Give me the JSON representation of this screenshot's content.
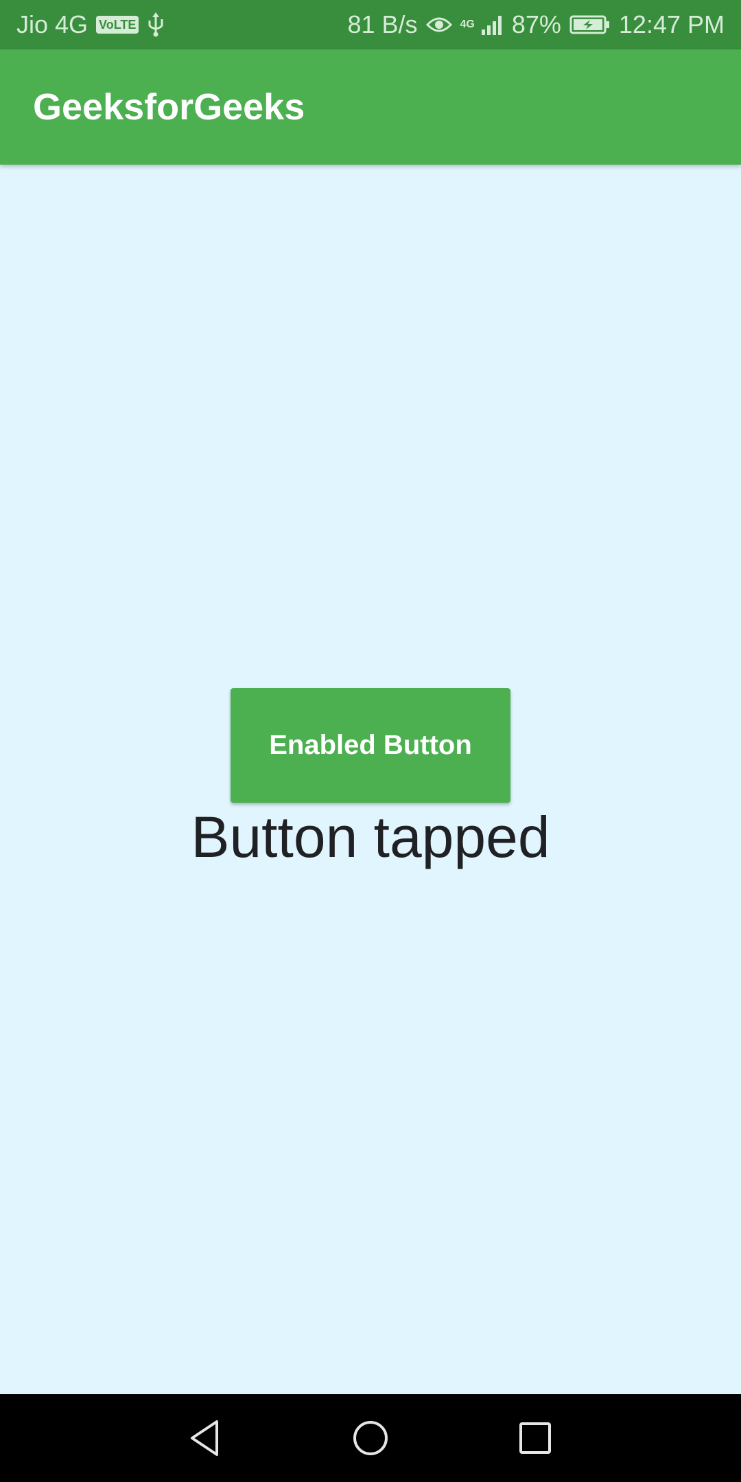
{
  "status_bar": {
    "carrier": "Jio 4G",
    "volte": "VoLTE",
    "net_speed": "81 B/s",
    "network_type": "4G",
    "battery": "87%",
    "time": "12:47 PM",
    "icons": [
      "usb-icon",
      "eye-icon",
      "signal-icon",
      "battery-icon"
    ]
  },
  "app_bar": {
    "title": "GeeksforGeeks"
  },
  "main": {
    "button_label": "Enabled Button",
    "status_text": "Button tapped"
  },
  "nav_bar": {
    "icons": [
      "back-icon",
      "home-icon",
      "recents-icon"
    ]
  },
  "colors": {
    "status_bar_bg": "#388e3c",
    "app_bar_bg": "#4caf50",
    "button_bg": "#4caf50",
    "page_bg": "#e1f5fe",
    "nav_bar_bg": "#000000"
  }
}
